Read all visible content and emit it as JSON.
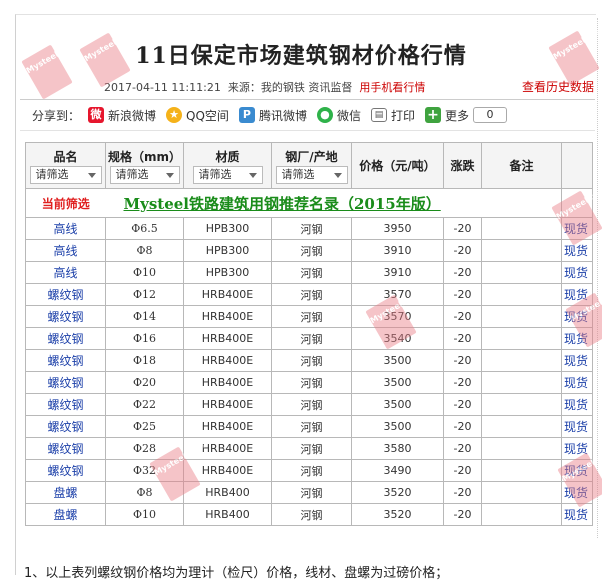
{
  "title": "11日保定市场建筑钢材价格行情",
  "meta": {
    "datetime": "2017-04-11 11:11:21",
    "source_label": "来源：",
    "source": "我的钢铁 资讯监督",
    "mobile_link": "用手机看行情",
    "history_link": "查看历史数据"
  },
  "share": {
    "label": "分享到：",
    "items": [
      {
        "name": "新浪微博",
        "icon": "weibo-icon",
        "color": "#e6162d"
      },
      {
        "name": "QQ空间",
        "icon": "qzone-icon",
        "color": "#f5b21a"
      },
      {
        "name": "腾讯微博",
        "icon": "tencent-weibo-icon",
        "color": "#3a8bd0"
      },
      {
        "name": "微信",
        "icon": "wechat-icon",
        "color": "#2fb24a"
      },
      {
        "name": "打印",
        "icon": "printer-icon",
        "color": "#555555"
      },
      {
        "name": "更多",
        "icon": "plus-icon",
        "color": "#3fa33f"
      }
    ],
    "count": "0"
  },
  "table": {
    "headers": {
      "name": "品名",
      "spec": "规格（mm）",
      "material": "材质",
      "origin": "钢厂/产地",
      "price": "价格（元/吨）",
      "change": "涨跌",
      "remark": "备注"
    },
    "filter_placeholder": "请筛选",
    "current_filter": "当前筛选",
    "recommend_link": "Mysteel铁路建筑用钢推荐名录（2015年版）",
    "rows": [
      {
        "name": "高线",
        "spec": "Φ6.5",
        "material": "HPB300",
        "origin": "河钢",
        "price": "3950",
        "change": "-20",
        "link": "现货"
      },
      {
        "name": "高线",
        "spec": "Φ8",
        "material": "HPB300",
        "origin": "河钢",
        "price": "3910",
        "change": "-20",
        "link": "现货"
      },
      {
        "name": "高线",
        "spec": "Φ10",
        "material": "HPB300",
        "origin": "河钢",
        "price": "3910",
        "change": "-20",
        "link": "现货"
      },
      {
        "name": "螺纹钢",
        "spec": "Φ12",
        "material": "HRB400E",
        "origin": "河钢",
        "price": "3570",
        "change": "-20",
        "link": "现货"
      },
      {
        "name": "螺纹钢",
        "spec": "Φ14",
        "material": "HRB400E",
        "origin": "河钢",
        "price": "3570",
        "change": "-20",
        "link": "现货"
      },
      {
        "name": "螺纹钢",
        "spec": "Φ16",
        "material": "HRB400E",
        "origin": "河钢",
        "price": "3540",
        "change": "-20",
        "link": "现货"
      },
      {
        "name": "螺纹钢",
        "spec": "Φ18",
        "material": "HRB400E",
        "origin": "河钢",
        "price": "3500",
        "change": "-20",
        "link": "现货"
      },
      {
        "name": "螺纹钢",
        "spec": "Φ20",
        "material": "HRB400E",
        "origin": "河钢",
        "price": "3500",
        "change": "-20",
        "link": "现货"
      },
      {
        "name": "螺纹钢",
        "spec": "Φ22",
        "material": "HRB400E",
        "origin": "河钢",
        "price": "3500",
        "change": "-20",
        "link": "现货"
      },
      {
        "name": "螺纹钢",
        "spec": "Φ25",
        "material": "HRB400E",
        "origin": "河钢",
        "price": "3500",
        "change": "-20",
        "link": "现货"
      },
      {
        "name": "螺纹钢",
        "spec": "Φ28",
        "material": "HRB400E",
        "origin": "河钢",
        "price": "3580",
        "change": "-20",
        "link": "现货"
      },
      {
        "name": "螺纹钢",
        "spec": "Φ32",
        "material": "HRB400E",
        "origin": "河钢",
        "price": "3490",
        "change": "-20",
        "link": "现货"
      },
      {
        "name": "盘螺",
        "spec": "Φ8",
        "material": "HRB400",
        "origin": "河钢",
        "price": "3520",
        "change": "-20",
        "link": "现货"
      },
      {
        "name": "盘螺",
        "spec": "Φ10",
        "material": "HRB400",
        "origin": "河钢",
        "price": "3520",
        "change": "-20",
        "link": "现货"
      }
    ]
  },
  "watermark_text": "Mysteel.com",
  "note": "1、以上表列螺纹钢价格均为理计（检尺）价格，线材、盘螺为过磅价格；"
}
